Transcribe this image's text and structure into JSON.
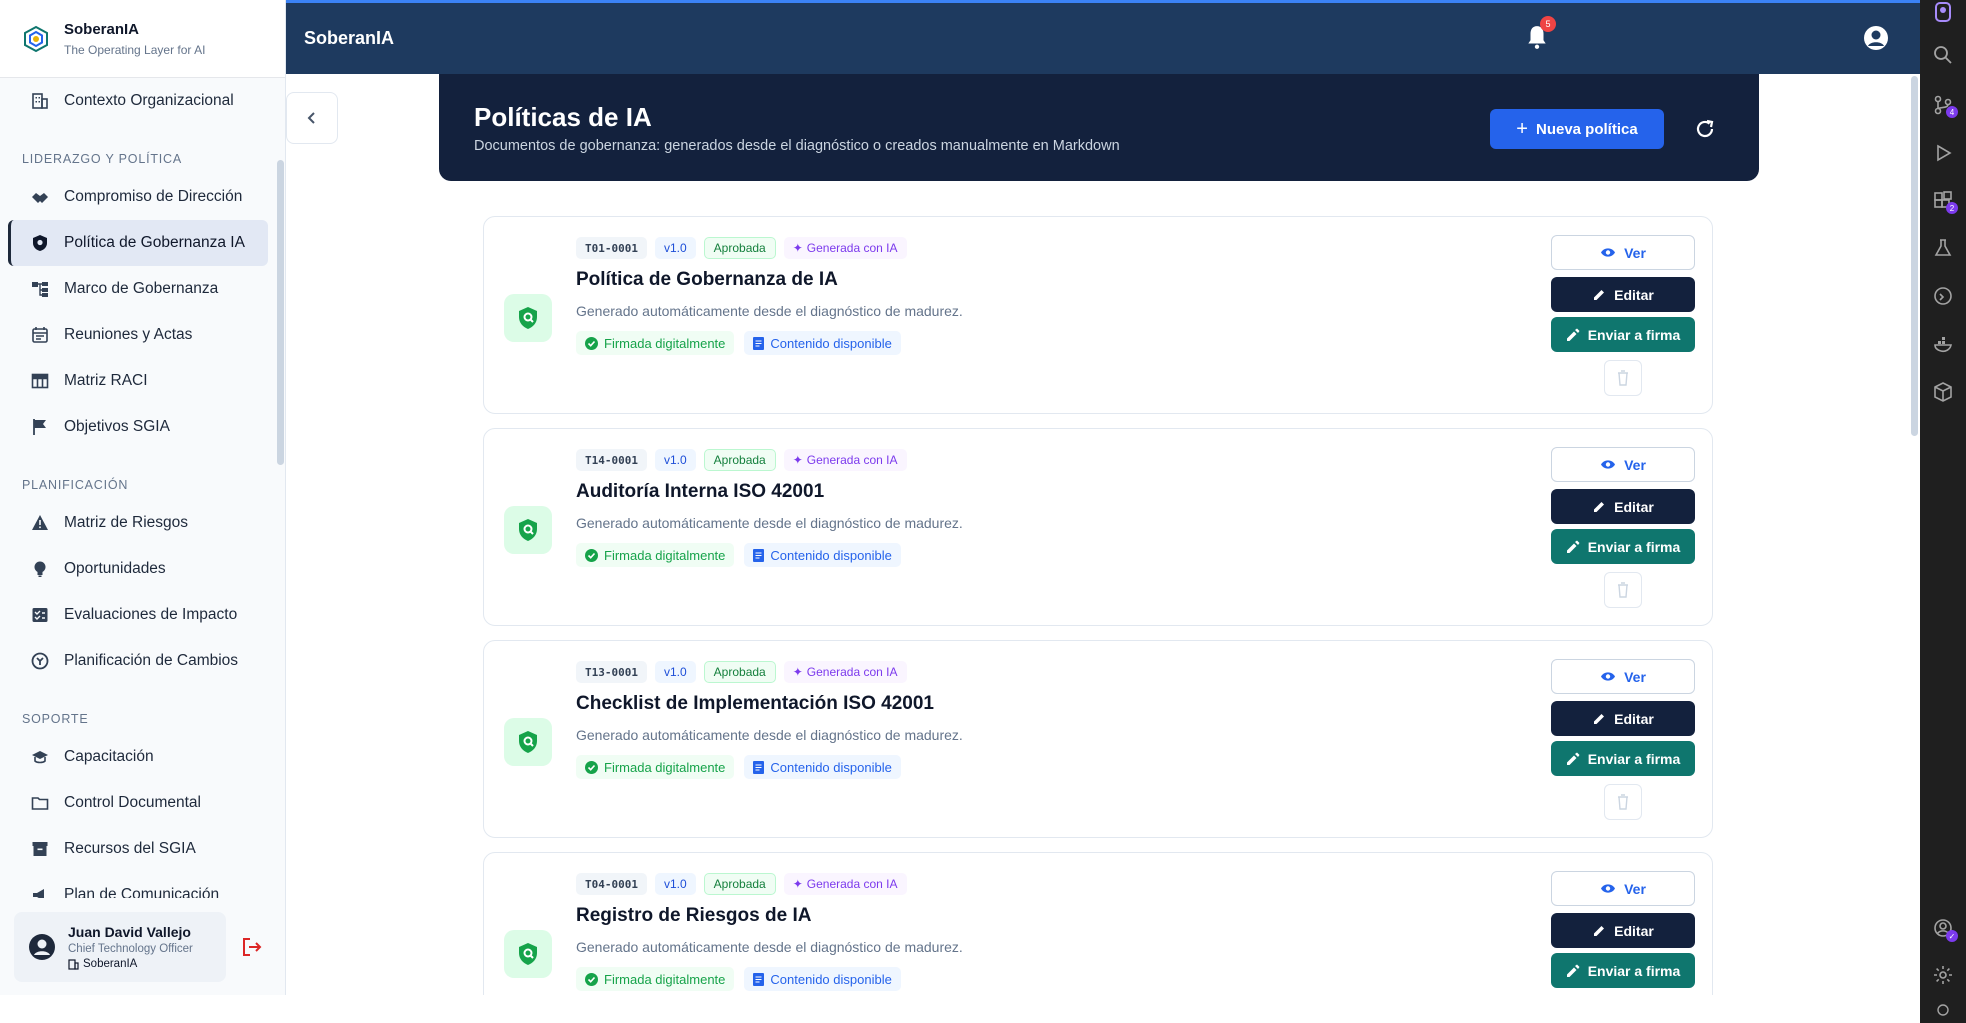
{
  "brand": {
    "name": "SoberanIA",
    "tagline": "The Operating Layer for AI"
  },
  "topbar": {
    "title": "SoberanIA",
    "notifications": "5"
  },
  "sidebar": {
    "first_item": "Contexto Organizacional",
    "sections": [
      {
        "title": "LIDERAZGO Y POLÍTICA",
        "items": [
          "Compromiso de Dirección",
          "Política de Gobernanza IA",
          "Marco de Gobernanza",
          "Reuniones y Actas",
          "Matriz RACI",
          "Objetivos SGIA"
        ]
      },
      {
        "title": "PLANIFICACIÓN",
        "items": [
          "Matriz de Riesgos",
          "Oportunidades",
          "Evaluaciones de Impacto",
          "Planificación de Cambios"
        ]
      },
      {
        "title": "SOPORTE",
        "items": [
          "Capacitación",
          "Control Documental",
          "Recursos del SGIA",
          "Plan de Comunicación"
        ]
      }
    ],
    "active_item": "Política de Gobernanza IA"
  },
  "user": {
    "name": "Juan David Vallejo",
    "role": "Chief Technology Officer",
    "org": "SoberanIA"
  },
  "hero": {
    "title": "Políticas de IA",
    "subtitle": "Documentos de gobernanza: generados desde el diagnóstico o creados manualmente en Markdown",
    "new_button": "Nueva política"
  },
  "card_labels": {
    "approved": "Aprobada",
    "ai_generated": "Generada con IA",
    "signed": "Firmada digitalmente",
    "content": "Contenido disponible",
    "view": "Ver",
    "edit": "Editar",
    "send_sign": "Enviar a firma"
  },
  "policies": [
    {
      "code": "T01-0001",
      "version": "v1.0",
      "title": "Política de Gobernanza de IA",
      "description": "Generado automáticamente desde el diagnóstico de madurez."
    },
    {
      "code": "T14-0001",
      "version": "v1.0",
      "title": "Auditoría Interna ISO 42001",
      "description": "Generado automáticamente desde el diagnóstico de madurez."
    },
    {
      "code": "T13-0001",
      "version": "v1.0",
      "title": "Checklist de Implementación ISO 42001",
      "description": "Generado automáticamente desde el diagnóstico de madurez."
    },
    {
      "code": "T04-0001",
      "version": "v1.0",
      "title": "Registro de Riesgos de IA",
      "description": "Generado automáticamente desde el diagnóstico de madurez."
    }
  ],
  "colors": {
    "navy": "#13213d",
    "topbar": "#1e3a5f",
    "primary": "#2563eb",
    "teal": "#0f766e",
    "success": "#16a34a",
    "ai_purple": "#7c3aed"
  }
}
